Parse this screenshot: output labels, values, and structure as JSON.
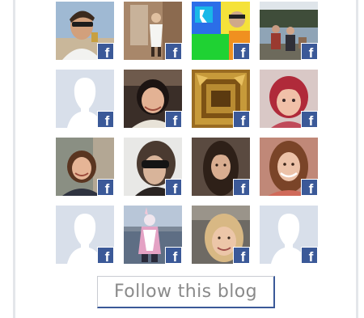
{
  "widget": {
    "follow_label": "Follow this blog",
    "badge_glyph": "f",
    "badge_color": "#3b5998"
  },
  "followers": [
    {
      "photo": "man-sunglasses",
      "placeholder": false
    },
    {
      "photo": "person-doorway",
      "placeholder": false
    },
    {
      "photo": "colorful-collage",
      "placeholder": false
    },
    {
      "photo": "people-outdoors",
      "placeholder": false
    },
    {
      "photo": "default-silhouette",
      "placeholder": true
    },
    {
      "photo": "smiling-woman-dark",
      "placeholder": false
    },
    {
      "photo": "ornate-frame",
      "placeholder": false
    },
    {
      "photo": "child-red-hair",
      "placeholder": false
    },
    {
      "photo": "woman-brown-hair",
      "placeholder": false
    },
    {
      "photo": "woman-sunglasses",
      "placeholder": false
    },
    {
      "photo": "woman-long-hair",
      "placeholder": false
    },
    {
      "photo": "woman-smiling",
      "placeholder": false
    },
    {
      "photo": "default-silhouette",
      "placeholder": true
    },
    {
      "photo": "costume-waterfront",
      "placeholder": false
    },
    {
      "photo": "blonde-woman",
      "placeholder": false
    },
    {
      "photo": "default-silhouette",
      "placeholder": true
    }
  ]
}
